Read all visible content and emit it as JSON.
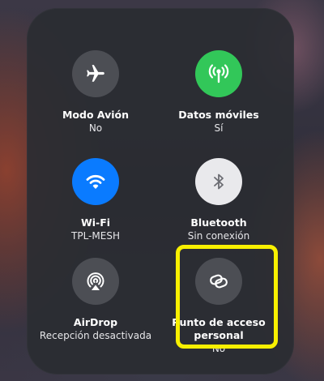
{
  "control_center": {
    "tiles": [
      {
        "title": "Modo Avión",
        "status": "No",
        "icon": "airplane-icon",
        "color": "#585a60",
        "active": false
      },
      {
        "title": "Datos móviles",
        "status": "Sí",
        "icon": "antenna-icon",
        "color": "#32c759",
        "active": true
      },
      {
        "title": "Wi-Fi",
        "status": "TPL-MESH",
        "icon": "wifi-icon",
        "color": "#0a7bff",
        "active": true
      },
      {
        "title": "Bluetooth",
        "status": "Sin conexión",
        "icon": "bluetooth-icon",
        "color": "#e9e9ec",
        "active": true
      },
      {
        "title": "AirDrop",
        "status": "Recepción desactivada",
        "icon": "airdrop-icon",
        "color": "#585a60",
        "active": false
      },
      {
        "title_line1": "Punto de acceso",
        "title_line2": "personal",
        "status": "No",
        "icon": "hotspot-link-icon",
        "color": "#585a60",
        "active": false
      }
    ],
    "highlight_color": "#f8f000"
  }
}
